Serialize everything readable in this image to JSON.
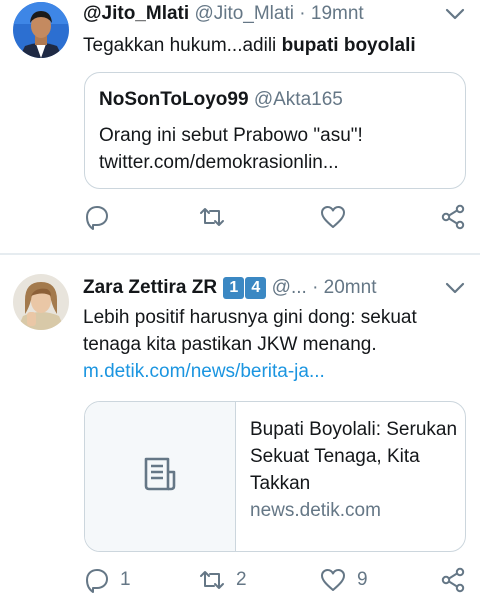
{
  "tweet1": {
    "name": "@Jito_Mlati",
    "handle": "@Jito_Mlati",
    "dot": "·",
    "time": "19mnt",
    "text_plain": "Tegakkan hukum...adili ",
    "text_bold": "bupati boyolali",
    "quote": {
      "name": "NoSonToLoyo99",
      "handle": "@Akta165",
      "text": "Orang ini sebut Prabowo \"asu\"!",
      "link": "twitter.com/demokrasionlin..."
    }
  },
  "tweet2": {
    "name": "Zara Zettira ZR",
    "badge1": "1",
    "badge2": "4",
    "handle": "@...",
    "dot": "·",
    "time": "20mnt",
    "text": "Lebih positif harusnya gini dong: sekuat tenaga kita pastikan JKW menang.",
    "link": "m.detik.com/news/berita-ja...",
    "card": {
      "title": "Bupati Boyolali: Serukan Sekuat Tenaga, Kita Takkan",
      "domain": "news.detik.com"
    },
    "replies": "1",
    "retweets": "2",
    "likes": "9"
  },
  "icons": {
    "reply": "reply-icon",
    "retweet": "retweet-icon",
    "like": "heart-icon",
    "share": "share-icon",
    "menu": "chevron-down-icon",
    "article": "article-icon"
  },
  "colors": {
    "text": "#14171a",
    "muted": "#657786",
    "link": "#1b95e0",
    "border": "#ccd6dd",
    "badge": "#3b88c3"
  }
}
